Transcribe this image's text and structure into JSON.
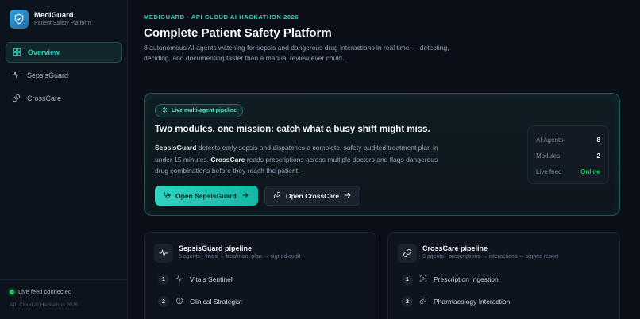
{
  "brand": {
    "title": "MediGuard",
    "subtitle": "Patient Safety Platform"
  },
  "sidebar": {
    "items": [
      {
        "label": "Overview",
        "icon": "grid-icon",
        "active": true
      },
      {
        "label": "SepsisGuard",
        "icon": "pulse-icon",
        "active": false
      },
      {
        "label": "CrossCare",
        "icon": "link-icon",
        "active": false
      }
    ],
    "footer": {
      "status": "Live feed connected",
      "event": "API Cloud AI Hackathon 2026"
    }
  },
  "header": {
    "eyebrow": "MEDIGUARD · API CLOUD AI HACKATHON 2026",
    "title": "Complete Patient Safety Platform",
    "description": "8 autonomous AI agents watching for sepsis and dangerous drug interactions in real time — detecting, deciding, and documenting faster than a manual review ever could."
  },
  "hero": {
    "badge": "Live multi-agent pipeline",
    "title": "Two modules, one mission: catch what a busy shift might miss.",
    "desc": {
      "m1": "SepsisGuard",
      "t1": " detects early sepsis and dispatches a complete, safety-audited treatment plan in under 15 minutes. ",
      "m2": "CrossCare",
      "t2": " reads prescriptions across multiple doctors and flags dangerous drug combinations before they reach the patient."
    },
    "primary_button": "Open SepsisGuard",
    "secondary_button": "Open CrossCare",
    "stats": [
      {
        "label": "AI Agents",
        "value": "8"
      },
      {
        "label": "Modules",
        "value": "2"
      },
      {
        "label": "Live feed",
        "value": "Online"
      }
    ]
  },
  "cards": [
    {
      "title": "SepsisGuard pipeline",
      "subtitle": "5 agents · vitals → treatment plan → signed audit",
      "steps": [
        {
          "num": "1",
          "label": "Vitals Sentinel",
          "icon": "pulse-icon"
        },
        {
          "num": "2",
          "label": "Clinical Strategist",
          "icon": "brain-icon"
        }
      ]
    },
    {
      "title": "CrossCare pipeline",
      "subtitle": "3 agents · prescriptions → interactions → signed report",
      "steps": [
        {
          "num": "1",
          "label": "Prescription Ingestion",
          "icon": "scan-icon"
        },
        {
          "num": "2",
          "label": "Pharmacology Interaction",
          "icon": "link-icon"
        }
      ]
    }
  ],
  "colors": {
    "accent": "#2dd4bf",
    "online": "#22c55e",
    "background": "#0a0f17"
  }
}
